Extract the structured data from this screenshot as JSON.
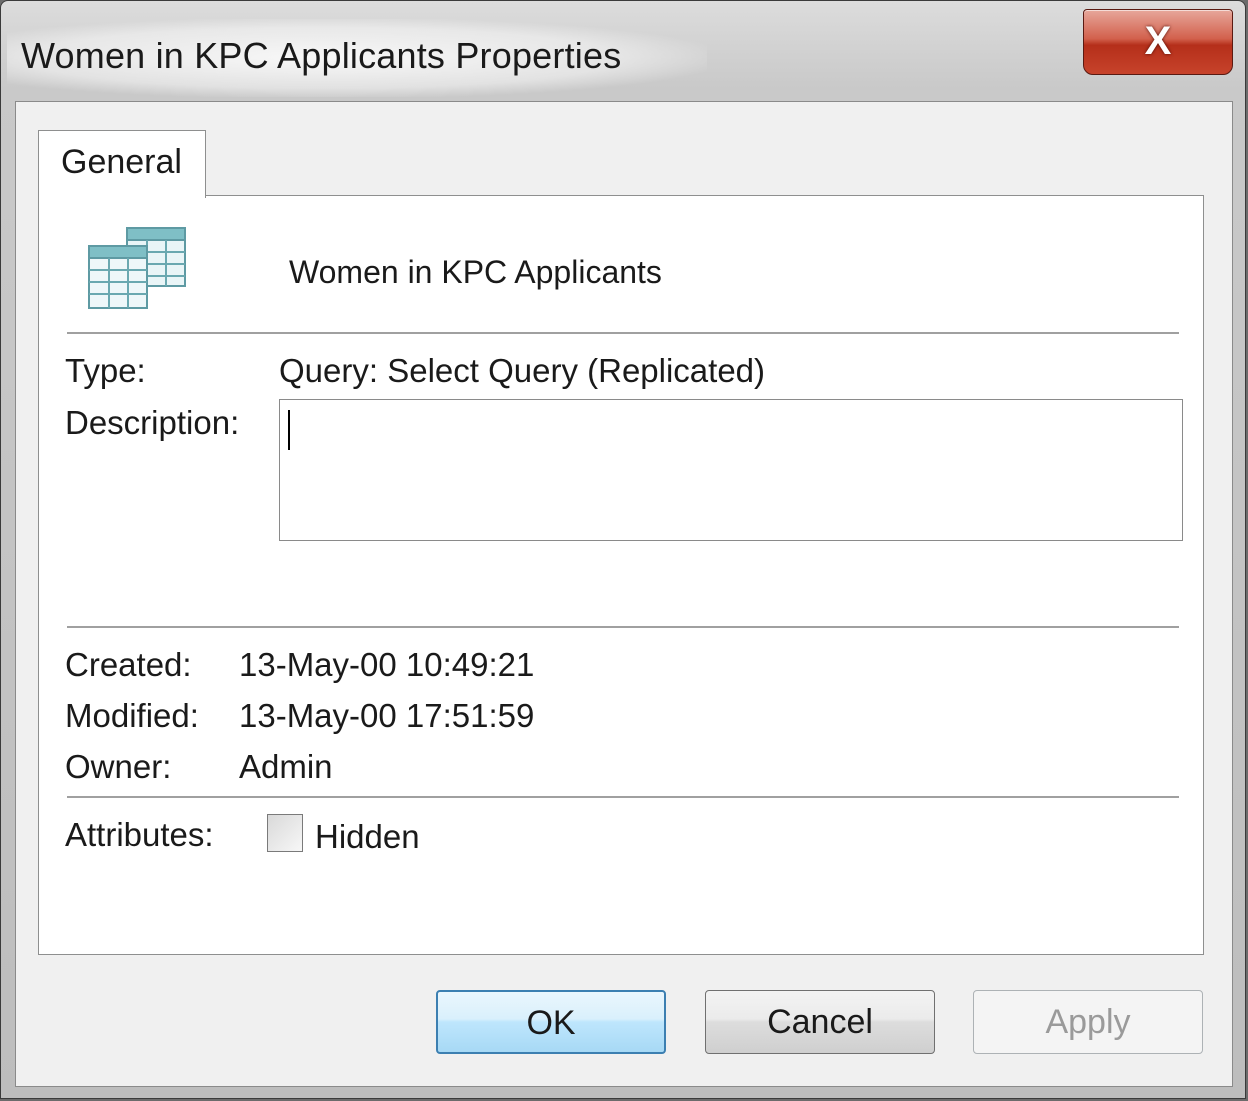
{
  "window": {
    "title": "Women in KPC Applicants Properties",
    "close_glyph": "X"
  },
  "tabs": [
    {
      "label": "General",
      "selected": true
    }
  ],
  "general": {
    "icon": "query-table-icon",
    "object_name": "Women in KPC Applicants",
    "type_label": "Type:",
    "type_value": "Query: Select Query (Replicated)",
    "description_label": "Description:",
    "description_value": "",
    "created_label": "Created:",
    "created_value": "13-May-00 10:49:21",
    "modified_label": "Modified:",
    "modified_value": "13-May-00 17:51:59",
    "owner_label": "Owner:",
    "owner_value": "Admin",
    "attributes_label": "Attributes:",
    "hidden_label": "Hidden",
    "hidden_checked": false
  },
  "buttons": {
    "ok": "OK",
    "cancel": "Cancel",
    "apply": "Apply"
  },
  "colors": {
    "close_button": "#c7432b",
    "default_button_border": "#3c7fb1"
  }
}
